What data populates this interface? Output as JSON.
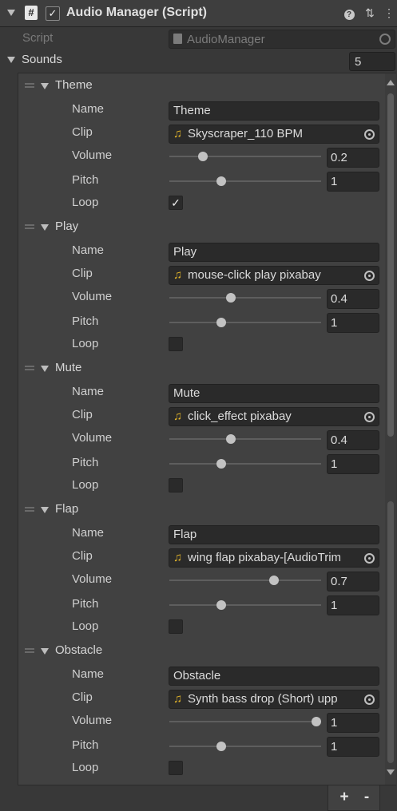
{
  "component": {
    "title": "Audio Manager (Script)",
    "script_icon": "#",
    "enabled_check": "✓",
    "help_icon": "?",
    "preset_icon": "⇅",
    "menu_icon": "⋮"
  },
  "script": {
    "label": "Script",
    "value": "AudioManager"
  },
  "sounds": {
    "label": "Sounds",
    "size": "5",
    "elements": [
      {
        "title": "Theme",
        "name": "Theme",
        "clip": "Skyscraper_110 BPM",
        "volume": "0.2",
        "volume_level": 0.2,
        "pitch": "1",
        "pitch_level": 0.33,
        "loop": true
      },
      {
        "title": "Play",
        "name": "Play",
        "clip": "mouse-click play pixabay",
        "volume": "0.4",
        "volume_level": 0.4,
        "pitch": "1",
        "pitch_level": 0.33,
        "loop": false
      },
      {
        "title": "Mute",
        "name": "Mute",
        "clip": "click_effect pixabay",
        "volume": "0.4",
        "volume_level": 0.4,
        "pitch": "1",
        "pitch_level": 0.33,
        "loop": false
      },
      {
        "title": "Flap",
        "name": "Flap",
        "clip": "wing flap pixabay-[AudioTrim",
        "volume": "0.7",
        "volume_level": 0.7,
        "pitch": "1",
        "pitch_level": 0.33,
        "loop": false
      },
      {
        "title": "Obstacle",
        "name": "Obstacle",
        "clip": "Synth bass drop (Short) upp",
        "volume": "1",
        "volume_level": 1.0,
        "pitch": "1",
        "pitch_level": 0.33,
        "loop": false
      }
    ]
  },
  "labels": {
    "name": "Name",
    "clip": "Clip",
    "volume": "Volume",
    "pitch": "Pitch",
    "loop": "Loop"
  },
  "icons": {
    "audio_clip": "♫",
    "checkmark": "✓"
  },
  "footer": {
    "add_label": "+",
    "remove_label": "-"
  },
  "colors": {
    "background": "#383838",
    "panel": "#414141",
    "field": "#2a2a2a",
    "audio_icon": "#e2b42a",
    "text": "#d2d2d2"
  }
}
